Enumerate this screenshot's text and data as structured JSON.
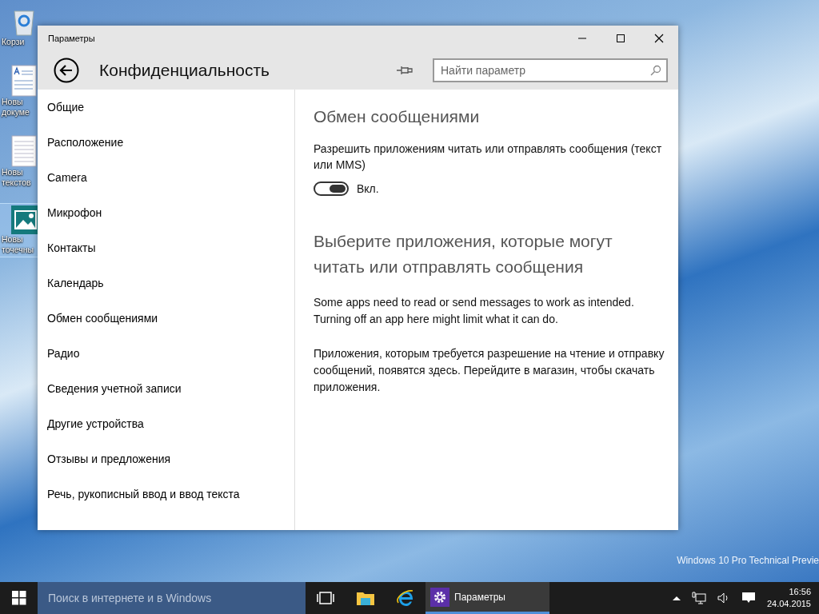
{
  "desktop": {
    "icons": [
      {
        "kind": "recycle",
        "label_lines": [
          "Корзи"
        ],
        "selected": false
      },
      {
        "kind": "document",
        "label_lines": [
          "Новы",
          "докуме"
        ],
        "selected": false
      },
      {
        "kind": "text",
        "label_lines": [
          "Новы",
          "текстов"
        ],
        "selected": false
      },
      {
        "kind": "image",
        "label_lines": [
          "Новы",
          "точечны"
        ],
        "selected": true
      }
    ],
    "watermark_text": "Windows 10 Pro Technical Previe"
  },
  "window": {
    "title": "Параметры",
    "page_title": "Конфиденциальность",
    "search": {
      "placeholder": "Найти параметр"
    },
    "sidebar": {
      "items": [
        {
          "label": "Общие"
        },
        {
          "label": "Расположение"
        },
        {
          "label": "Camera"
        },
        {
          "label": "Микрофон"
        },
        {
          "label": "Контакты"
        },
        {
          "label": "Календарь"
        },
        {
          "label": "Обмен сообщениями"
        },
        {
          "label": "Радио"
        },
        {
          "label": "Сведения учетной записи"
        },
        {
          "label": "Другие устройства"
        },
        {
          "label": "Отзывы и предложения"
        },
        {
          "label": "Речь, рукописный ввод и ввод текста"
        }
      ]
    },
    "content": {
      "heading": "Обмен сообщениями",
      "setting_label": "Разрешить приложениям читать или отправлять сообщения (текст или MMS)",
      "toggle": {
        "on": true,
        "label": "Вкл."
      },
      "apps_heading": "Выберите приложения, которые могут читать или отправлять сообщения",
      "paragraphs": [
        "Some apps need to read or send messages to work as intended. Turning off an app here might limit what it can do.",
        "Приложения, которым требуется разрешение на чтение и отправку сообщений, появятся здесь. Перейдите в магазин, чтобы скачать приложения."
      ]
    }
  },
  "taskbar": {
    "search_placeholder": "Поиск в интернете и в Windows",
    "pinned": [
      {
        "kind": "task-view"
      },
      {
        "kind": "explorer"
      },
      {
        "kind": "browser"
      }
    ],
    "apps": [
      {
        "label": "Параметры",
        "selected": true
      }
    ],
    "clock": {
      "time": "16:56",
      "date": "24.04.2015"
    }
  }
}
